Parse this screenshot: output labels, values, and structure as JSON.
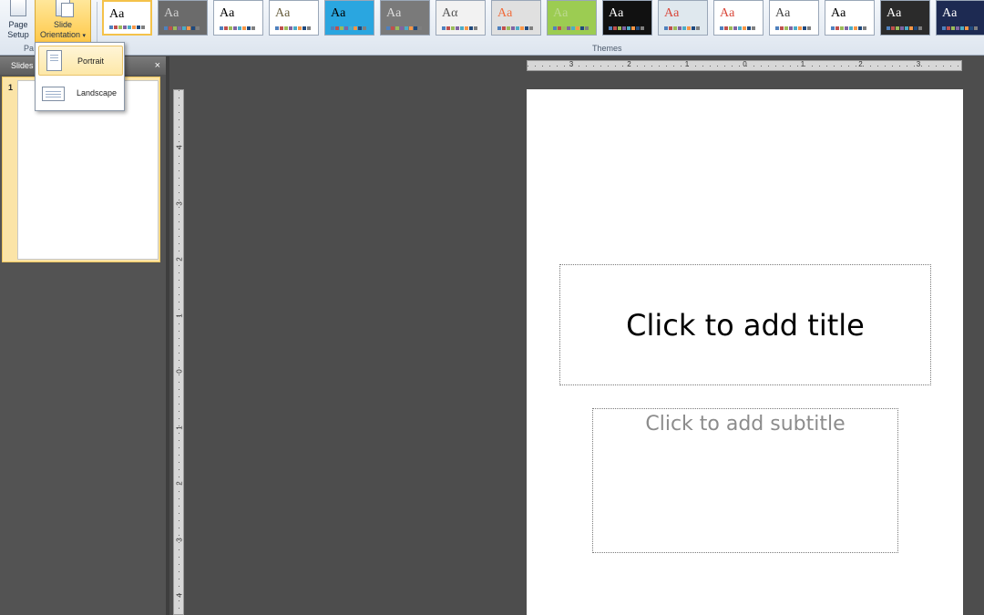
{
  "ribbon": {
    "page_setup": {
      "line1": "Page",
      "line2": "Setup"
    },
    "slide_orientation": {
      "line1": "Slide",
      "line2": "Orientation",
      "caret": "▾"
    },
    "groups": {
      "page_setup_label": "Pa",
      "themes_label": "Themes"
    },
    "themes": [
      {
        "label": "Aa",
        "bg": "#ffffff",
        "fg": "#000000",
        "selected": true
      },
      {
        "label": "Aa",
        "bg": "#6b6b6b",
        "fg": "#cfcfcf"
      },
      {
        "label": "Aa",
        "bg": "#ffffff",
        "fg": "#000000"
      },
      {
        "label": "Aa",
        "bg": "#ffffff",
        "fg": "#6a6040"
      },
      {
        "label": "Aa",
        "bg": "#2aa6e0",
        "fg": "#000000"
      },
      {
        "label": "Aa",
        "bg": "#7a7a7a",
        "fg": "#dcdcdc"
      },
      {
        "label": "Aα",
        "bg": "#f2f2f2",
        "fg": "#555555"
      },
      {
        "label": "Aa",
        "bg": "#e0e0e0",
        "fg": "#f06c3c"
      },
      {
        "label": "Aa",
        "bg": "#9ccc52",
        "fg": "#bcd98f"
      },
      {
        "label": "Aa",
        "bg": "#111111",
        "fg": "#ffffff"
      },
      {
        "label": "Aa",
        "bg": "#dfe8ee",
        "fg": "#d9483b"
      },
      {
        "label": "Aa",
        "bg": "#ffffff",
        "fg": "#d9483b"
      },
      {
        "label": "Aa",
        "bg": "#ffffff",
        "fg": "#444444"
      },
      {
        "label": "Aa",
        "bg": "#ffffff",
        "fg": "#000000"
      },
      {
        "label": "Aa",
        "bg": "#2b2b2b",
        "fg": "#ffffff"
      },
      {
        "label": "Aa",
        "bg": "#1d2a52",
        "fg": "#ffffff"
      }
    ]
  },
  "orientation_menu": {
    "portrait": "Portrait",
    "landscape": "Landscape"
  },
  "slides_pane": {
    "title": "Slides",
    "close": "×",
    "slide_number": "1"
  },
  "ruler": {
    "horizontal_ticks": [
      "3",
      "2",
      "1",
      "0",
      "1",
      "2",
      "3"
    ],
    "vertical_ticks": [
      "4",
      "3",
      "2",
      "1",
      "0",
      "1",
      "2",
      "3",
      "4"
    ]
  },
  "slide": {
    "title_placeholder": "Click to add title",
    "subtitle_placeholder": "Click to add subtitle"
  }
}
